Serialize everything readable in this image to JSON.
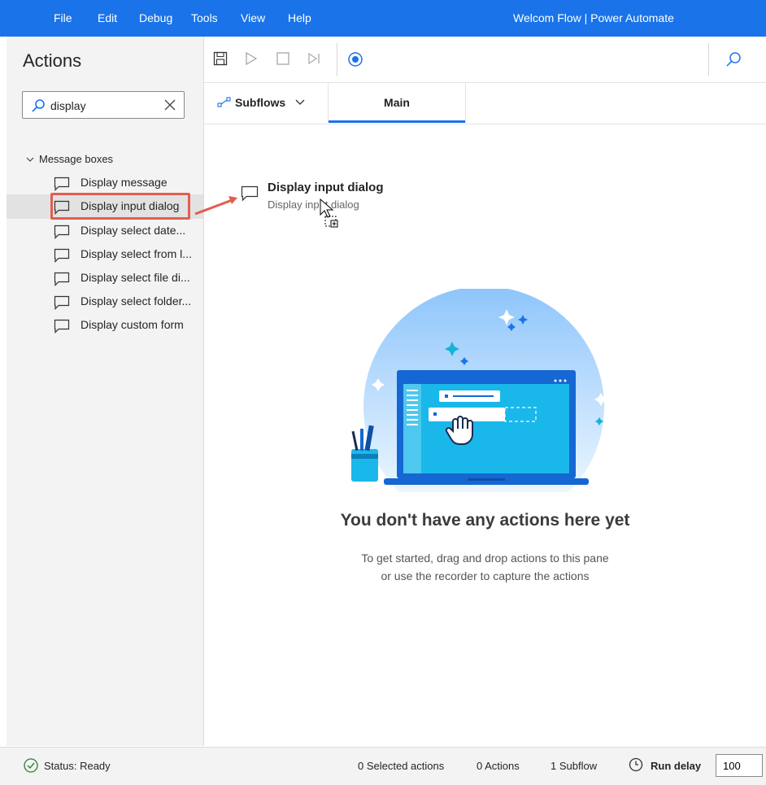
{
  "window": {
    "title": "Welcom Flow | Power Automate"
  },
  "menu": [
    "File",
    "Edit",
    "Debug",
    "Tools",
    "View",
    "Help"
  ],
  "actions_pane": {
    "title": "Actions",
    "search": {
      "value": "display"
    },
    "group": "Message boxes",
    "items": [
      "Display message",
      "Display input dialog",
      "Display select date...",
      "Display select from l...",
      "Display select file di...",
      "Display select folder...",
      "Display custom form"
    ],
    "selected_index": 1
  },
  "toolbar": {
    "icons": [
      "save-icon",
      "play-icon",
      "stop-icon",
      "step-icon",
      "record-icon",
      "search-icon"
    ]
  },
  "tabs": {
    "subflows_label": "Subflows",
    "main_label": "Main"
  },
  "drag_preview": {
    "title": "Display input dialog",
    "subtitle": "Display input dialog"
  },
  "empty_state": {
    "title": "You don't have any actions here yet",
    "line1": "To get started, drag and drop actions to this pane",
    "line2": "or use the recorder to capture the actions"
  },
  "status": {
    "status": "Status: Ready",
    "selected": "0 Selected actions",
    "actions": "0 Actions",
    "subflows": "1 Subflow",
    "run_delay_label": "Run delay",
    "run_delay_value": "100"
  },
  "colors": {
    "accent": "#1a73e8",
    "highlight": "#e35d4f"
  }
}
